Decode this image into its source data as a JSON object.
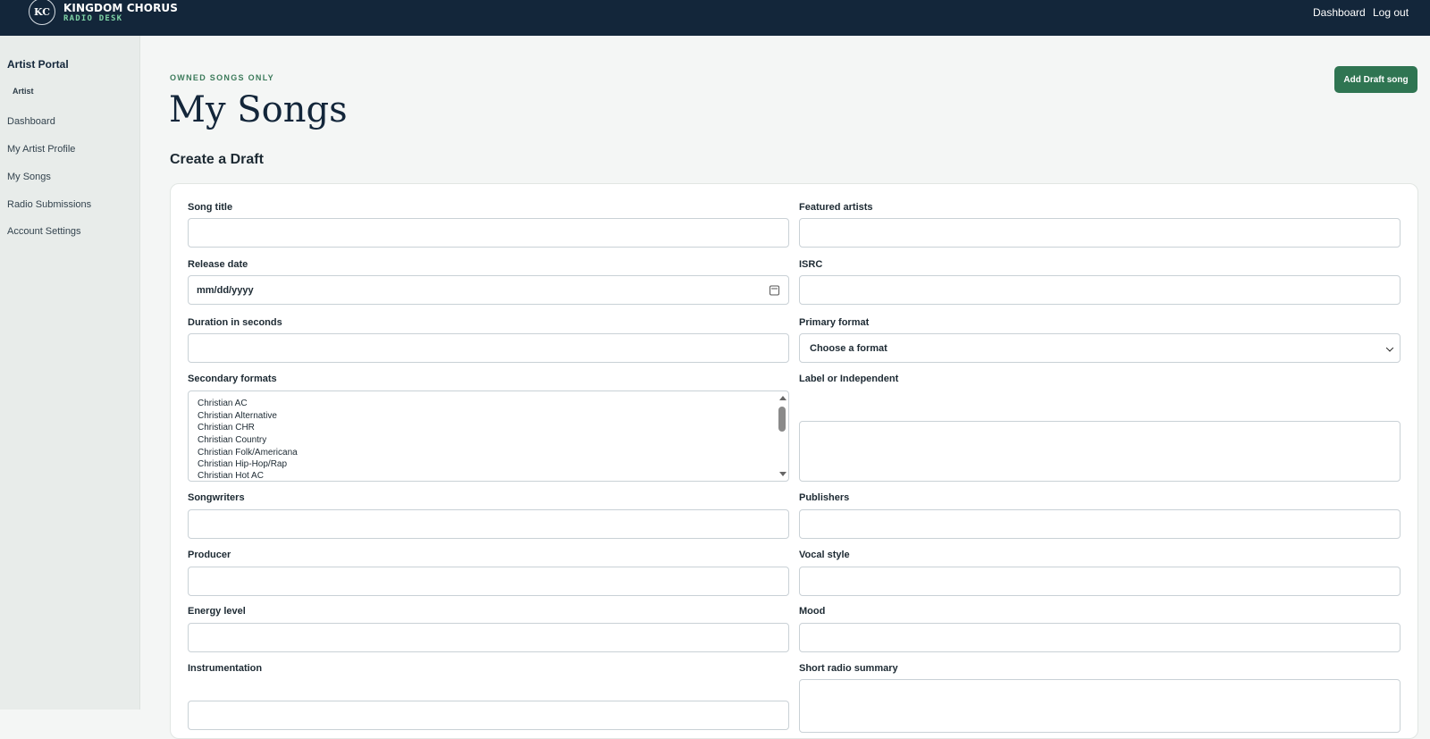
{
  "brand": {
    "badge": "KC",
    "name": "KINGDOM CHORUS",
    "sub": "RADIO DESK"
  },
  "topnav": {
    "dashboard": "Dashboard",
    "logout": "Log out"
  },
  "sidebar": {
    "title": "Artist Portal",
    "role": "Artist",
    "items": [
      {
        "label": "Dashboard"
      },
      {
        "label": "My Artist Profile"
      },
      {
        "label": "My Songs"
      },
      {
        "label": "Radio Submissions"
      },
      {
        "label": "Account Settings"
      }
    ]
  },
  "page": {
    "eyebrow": "OWNED SONGS ONLY",
    "title": "My Songs",
    "add_button": "Add Draft song",
    "section_title": "Create a Draft"
  },
  "form": {
    "song_title": {
      "label": "Song title",
      "value": ""
    },
    "featured_artists": {
      "label": "Featured artists",
      "value": ""
    },
    "release_date": {
      "label": "Release date",
      "placeholder": "mm/dd/yyyy"
    },
    "isrc": {
      "label": "ISRC",
      "value": ""
    },
    "duration": {
      "label": "Duration in seconds",
      "value": ""
    },
    "primary_format": {
      "label": "Primary format",
      "selected": "Choose a format"
    },
    "secondary_formats": {
      "label": "Secondary formats",
      "options": [
        "Christian AC",
        "Christian Alternative",
        "Christian CHR",
        "Christian Country",
        "Christian Folk/Americana",
        "Christian Hip-Hop/Rap",
        "Christian Hot AC"
      ]
    },
    "label_or_independent": {
      "label": "Label or Independent",
      "value": ""
    },
    "songwriters": {
      "label": "Songwriters",
      "value": ""
    },
    "publishers": {
      "label": "Publishers",
      "value": ""
    },
    "producer": {
      "label": "Producer",
      "value": ""
    },
    "vocal_style": {
      "label": "Vocal style",
      "value": ""
    },
    "energy_level": {
      "label": "Energy level",
      "value": ""
    },
    "mood": {
      "label": "Mood",
      "value": ""
    },
    "instrumentation": {
      "label": "Instrumentation",
      "value": ""
    },
    "short_radio_summary": {
      "label": "Short radio summary",
      "value": ""
    }
  }
}
